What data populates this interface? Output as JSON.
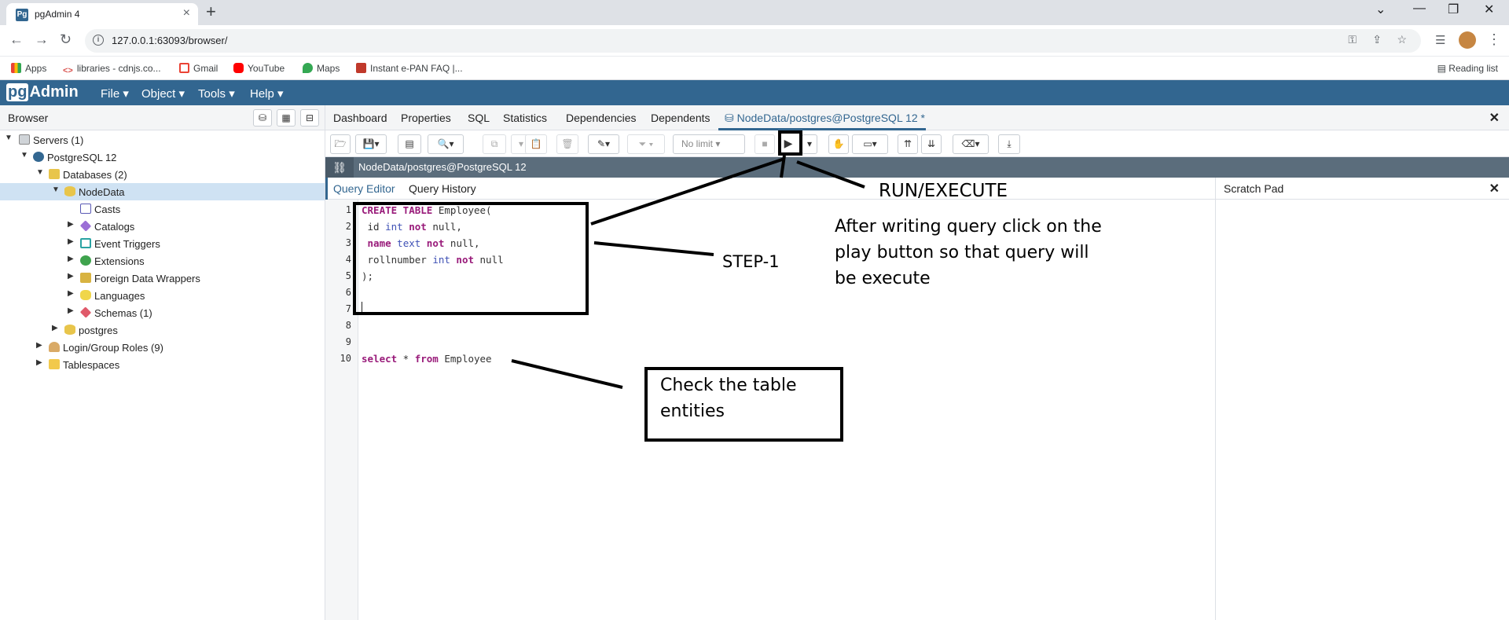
{
  "browser": {
    "tab_title": "pgAdmin 4",
    "tab_icon_text": "Pg",
    "url": "127.0.0.1:63093/browser/",
    "bookmarks": [
      "Apps",
      "libraries - cdnjs.co...",
      "Gmail",
      "YouTube",
      "Maps",
      "Instant e-PAN FAQ |..."
    ],
    "reading_list": "Reading list"
  },
  "navbar": {
    "logo_pg": "pg",
    "logo_admin": "Admin",
    "menus": [
      "File",
      "Object",
      "Tools",
      "Help"
    ]
  },
  "sidebar": {
    "title": "Browser",
    "tree": [
      {
        "label": "Servers (1)",
        "icon": "servers-icon"
      },
      {
        "label": "PostgreSQL 12",
        "icon": "postgres-server-icon"
      },
      {
        "label": "Databases (2)",
        "icon": "databases-icon"
      },
      {
        "label": "NodeData",
        "icon": "database-icon"
      },
      {
        "label": "Casts",
        "icon": "casts-icon"
      },
      {
        "label": "Catalogs",
        "icon": "catalogs-icon"
      },
      {
        "label": "Event Triggers",
        "icon": "event-triggers-icon"
      },
      {
        "label": "Extensions",
        "icon": "extensions-icon"
      },
      {
        "label": "Foreign Data Wrappers",
        "icon": "fdw-icon"
      },
      {
        "label": "Languages",
        "icon": "languages-icon"
      },
      {
        "label": "Schemas (1)",
        "icon": "schemas-icon"
      },
      {
        "label": "postgres",
        "icon": "database-icon"
      },
      {
        "label": "Login/Group Roles (9)",
        "icon": "roles-icon"
      },
      {
        "label": "Tablespaces",
        "icon": "tablespaces-icon"
      }
    ]
  },
  "main": {
    "tabs": [
      "Dashboard",
      "Properties",
      "SQL",
      "Statistics",
      "Dependencies",
      "Dependents",
      "NodeData/postgres@PostgreSQL 12 *"
    ],
    "toolbar": {
      "limit": "No limit"
    },
    "connection": "NodeData/postgres@PostgreSQL 12",
    "query_tabs": [
      "Query Editor",
      "Query History"
    ],
    "line_numbers": [
      "1",
      "2",
      "3",
      "4",
      "5",
      "6",
      "7",
      "8",
      "9",
      "10"
    ],
    "code": {
      "l1_kw": "CREATE TABLE",
      "l1_rest": " Employee(",
      "l2_a": " id ",
      "l2_ty": "int",
      "l2_kw": " not",
      "l2_rest": " null,",
      "l3_a": " ",
      "l3_kw1": "name",
      "l3_ty": " text",
      "l3_kw2": " not",
      "l3_rest": " null,",
      "l4_a": " rollnumber ",
      "l4_ty": "int",
      "l4_kw": " not",
      "l4_rest": " null",
      "l5": ");",
      "l10_kw1": "select",
      "l10_mid": " * ",
      "l10_kw2": "from",
      "l10_rest": " Employee"
    },
    "scratch_title": "Scratch Pad"
  },
  "annotations": {
    "run_execute": "RUN/EXECUTE",
    "step1": "STEP-1",
    "instruction": "After writing query click on the play button so that query will be execute",
    "check": "Check the table entities"
  }
}
